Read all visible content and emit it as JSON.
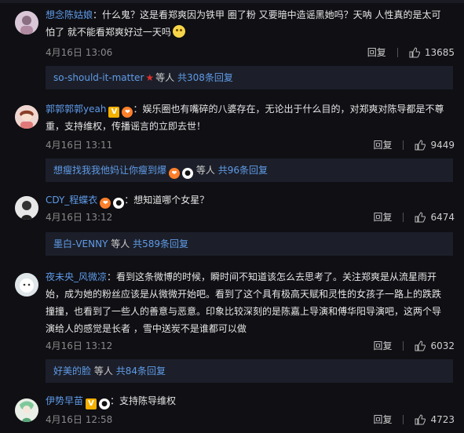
{
  "comments": [
    {
      "user": "想念陈姑娘",
      "content": "：什么鬼？这是看郑爽因为铁甲 圈了粉 又要暗中造谣黑她吗？天呐 人性真的是太可怕了 就不能看郑爽好过一天吗",
      "date": "4月16日 13:06",
      "reply_label": "回复",
      "likes": "13685",
      "sub": {
        "user": "so-should-it-matter",
        "mid": "等人",
        "count": "共308条回复"
      }
    },
    {
      "user": "郭郭郭郭yeah",
      "content": "：娱乐圈也有嘴碎的八婆存在，无论出于什么目的，对郑爽对陈导都是不尊重，支持维权，传播谣言的立即去世！",
      "date": "4月16日 13:11",
      "reply_label": "回复",
      "likes": "9449",
      "sub": {
        "user": "想瘦找我我他妈让你瘦到爆",
        "mid": "等人",
        "count": "共96条回复"
      }
    },
    {
      "user": "CDY_程蝶衣",
      "content": "：想知道哪个女星？",
      "date": "4月16日 13:12",
      "reply_label": "回复",
      "likes": "6474",
      "sub": {
        "user": "墨白-VENNY",
        "mid": "等人",
        "count": "共589条回复"
      }
    },
    {
      "user": "夜未央_风微凉",
      "content": "：看到这条微博的时候，瞬时间不知道该怎么去思考了。关注郑爽是从流星雨开始，成为她的粉丝应该是从微微开始吧。看到了这个具有极高天赋和灵性的女孩子一路上的跌跌撞撞，也看到了一些人的善意与恶意。印象比较深刻的是陈嘉上导演和傅华阳导演吧，这两个导演给人的感觉是长者 ，雪中送炭不是谁都可以做",
      "date": "4月16日 13:12",
      "reply_label": "回复",
      "likes": "6032",
      "sub": {
        "user": "好美的脸",
        "mid": "等人",
        "count": "共84条回复"
      }
    },
    {
      "user": "伊势早苗",
      "content": "：支持陈导维权",
      "date": "4月16日 12:58",
      "reply_label": "回复",
      "likes": "4723"
    }
  ],
  "colors": {
    "background": "#0f0f14",
    "link": "#5f9be8",
    "subbox": "#1c1f29",
    "meta": "#8a8a8a"
  },
  "icons": [
    "avatar",
    "v-badge",
    "vip-badge",
    "panda-badge",
    "smile-emoji",
    "thumbs-up-icon",
    "red-star-icon"
  ]
}
